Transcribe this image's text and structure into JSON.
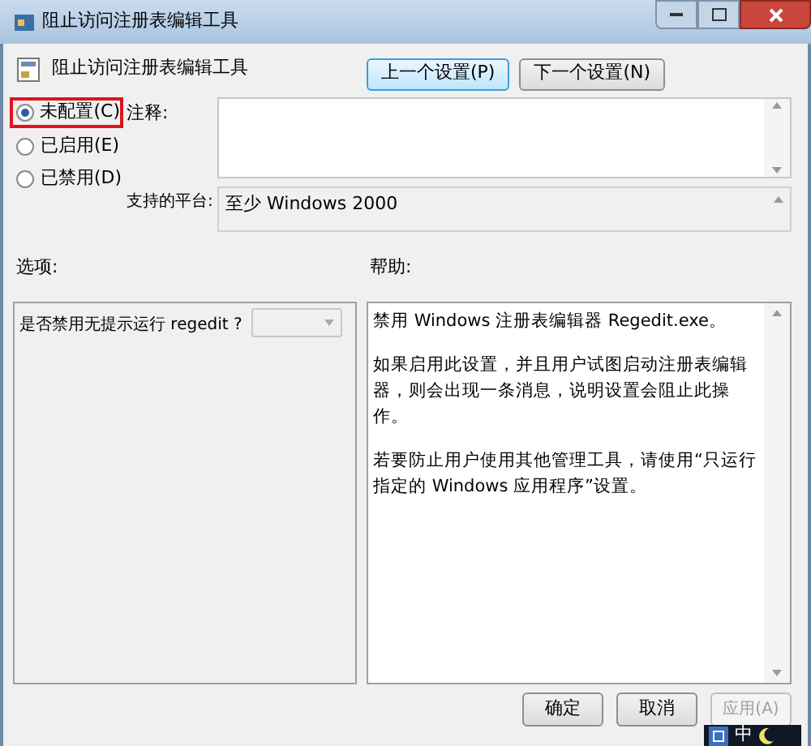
{
  "window": {
    "title": "阻止访问注册表编辑工具"
  },
  "header": {
    "title": "阻止访问注册表编辑工具"
  },
  "nav_buttons": [
    {
      "label": "上一个设置(P)",
      "selected": true
    },
    {
      "label": "下一个设置(N)",
      "selected": false
    }
  ],
  "radios": [
    {
      "label": "未配置(C)",
      "selected": true,
      "highlighted": true
    },
    {
      "label": "已启用(E)",
      "selected": false,
      "highlighted": false
    },
    {
      "label": "已禁用(D)",
      "selected": false,
      "highlighted": false
    }
  ],
  "comment": {
    "label": "注释:"
  },
  "platform": {
    "label": "支持的平台:",
    "value": "至少 Windows 2000"
  },
  "options": {
    "label": "选项:",
    "question": "是否禁用无提示运行 regedit ?",
    "dropdown_disabled": true
  },
  "help": {
    "label": "帮助:",
    "paragraphs": [
      "禁用 Windows 注册表编辑器 Regedit.exe。",
      "如果启用此设置，并且用户试图启动注册表编辑器，则会出现一条消息，说明设置会阻止此操作。",
      "若要防止用户使用其他管理工具，请使用“只运行指定的 Windows 应用程序”设置。"
    ]
  },
  "footer_buttons": [
    {
      "label": "确定",
      "disabled": false
    },
    {
      "label": "取消",
      "disabled": false
    },
    {
      "label": "应用(A)",
      "disabled": true
    }
  ],
  "ime_bar": {
    "label": "中"
  }
}
